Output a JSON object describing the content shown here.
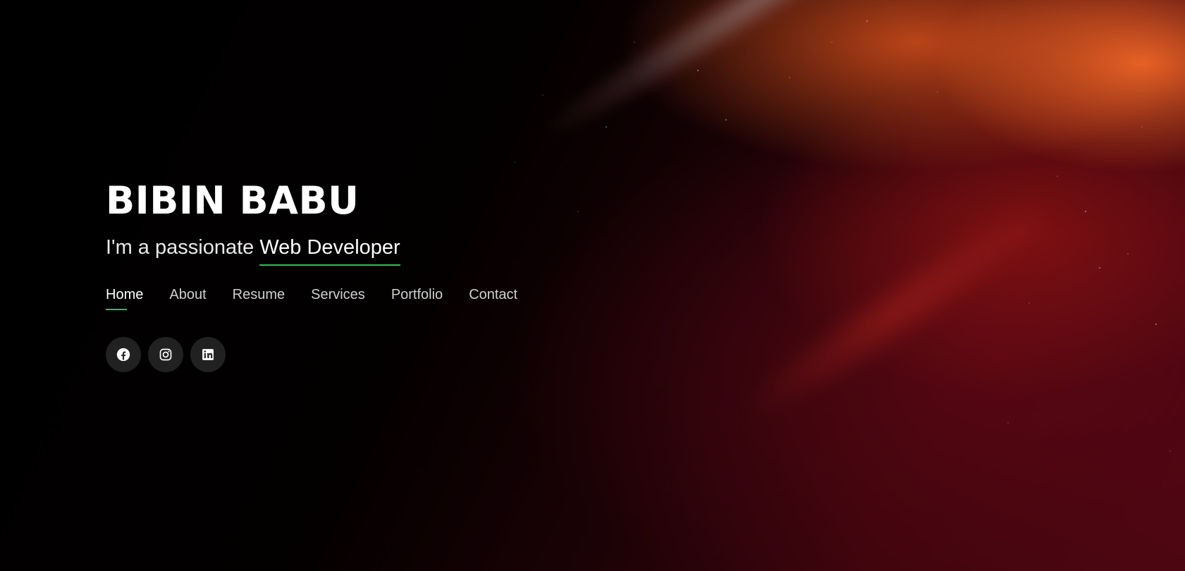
{
  "hero": {
    "name": "BIBIN BABU",
    "tagline_prefix": "I'm a passionate",
    "tagline_role": "Web Developer"
  },
  "nav": {
    "items": [
      "Home",
      "About",
      "Resume",
      "Services",
      "Portfolio",
      "Contact"
    ],
    "active": "Home"
  },
  "social": {
    "icons": [
      "facebook-icon",
      "instagram-icon",
      "linkedin-icon"
    ]
  },
  "colors": {
    "accent": "#2fbf56",
    "background": "#000000",
    "text": "#ffffff"
  }
}
